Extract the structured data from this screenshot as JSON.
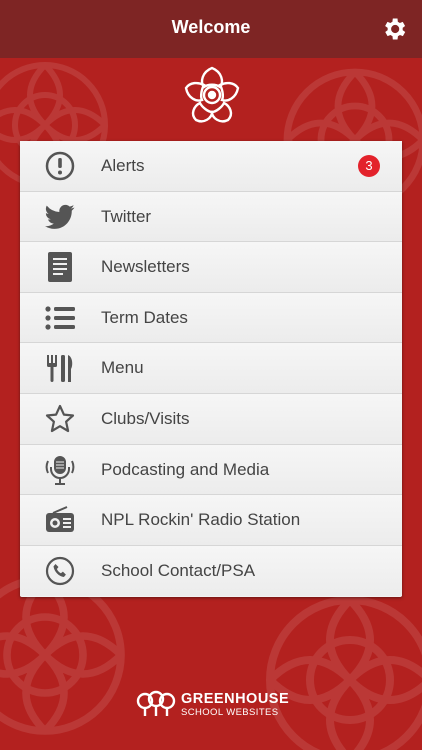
{
  "header": {
    "title": "Welcome"
  },
  "menu": {
    "items": [
      {
        "label": "Alerts",
        "icon": "alert-icon",
        "badge": "3"
      },
      {
        "label": "Twitter",
        "icon": "twitter-icon"
      },
      {
        "label": "Newsletters",
        "icon": "document-icon"
      },
      {
        "label": "Term Dates",
        "icon": "list-icon"
      },
      {
        "label": "Menu",
        "icon": "cutlery-icon"
      },
      {
        "label": "Clubs/Visits",
        "icon": "star-icon"
      },
      {
        "label": "Podcasting and Media",
        "icon": "microphone-icon"
      },
      {
        "label": "NPL Rockin' Radio Station",
        "icon": "radio-icon"
      },
      {
        "label": "School Contact/PSA",
        "icon": "phone-icon"
      }
    ]
  },
  "footer": {
    "brand": "GREENHOUSE",
    "brand_sub": "SCHOOL WEBSITES"
  },
  "colors": {
    "background": "#b3211f",
    "header": "#7e2524",
    "badge": "#e3222b",
    "icon": "#555555"
  }
}
